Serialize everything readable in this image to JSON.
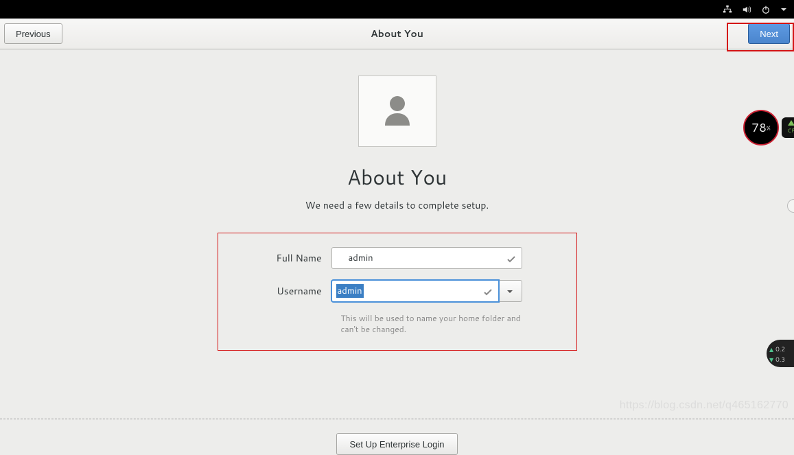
{
  "topbar": {
    "icons": [
      "network-wired-icon",
      "volume-icon",
      "power-icon",
      "menu-dropdown-icon"
    ]
  },
  "header": {
    "previous_label": "Previous",
    "title": "About You",
    "next_label": "Next"
  },
  "main": {
    "heading": "About You",
    "subheading": "We need a few details to complete setup.",
    "fullname_label": "Full Name",
    "fullname_value": "admin",
    "username_label": "Username",
    "username_value": "admin",
    "username_help": "This will be used to name your home folder and can't be changed.",
    "enterprise_label": "Set Up Enterprise Login"
  },
  "widgets": {
    "cpu_value": "78",
    "cpu_unit": "%",
    "cpu_label": "CP",
    "net_up": "0.2",
    "net_down": "0.3"
  },
  "watermark": "https://blog.csdn.net/q465162770"
}
